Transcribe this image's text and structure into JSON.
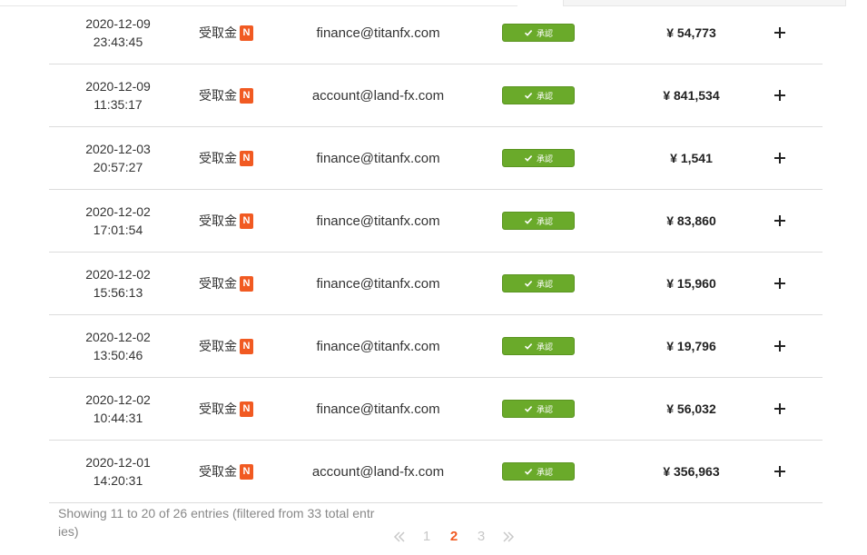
{
  "rows": [
    {
      "date": "2020-12-09",
      "time": "23:43:45",
      "type": "受取金",
      "badge": "N",
      "email": "finance@titanfx.com",
      "status": "承認",
      "amount": "¥ 54,773"
    },
    {
      "date": "2020-12-09",
      "time": "11:35:17",
      "type": "受取金",
      "badge": "N",
      "email": "account@land-fx.com",
      "status": "承認",
      "amount": "¥ 841,534"
    },
    {
      "date": "2020-12-03",
      "time": "20:57:27",
      "type": "受取金",
      "badge": "N",
      "email": "finance@titanfx.com",
      "status": "承認",
      "amount": "¥ 1,541"
    },
    {
      "date": "2020-12-02",
      "time": "17:01:54",
      "type": "受取金",
      "badge": "N",
      "email": "finance@titanfx.com",
      "status": "承認",
      "amount": "¥ 83,860"
    },
    {
      "date": "2020-12-02",
      "time": "15:56:13",
      "type": "受取金",
      "badge": "N",
      "email": "finance@titanfx.com",
      "status": "承認",
      "amount": "¥ 15,960"
    },
    {
      "date": "2020-12-02",
      "time": "13:50:46",
      "type": "受取金",
      "badge": "N",
      "email": "finance@titanfx.com",
      "status": "承認",
      "amount": "¥ 19,796"
    },
    {
      "date": "2020-12-02",
      "time": "10:44:31",
      "type": "受取金",
      "badge": "N",
      "email": "finance@titanfx.com",
      "status": "承認",
      "amount": "¥ 56,032"
    },
    {
      "date": "2020-12-01",
      "time": "14:20:31",
      "type": "受取金",
      "badge": "N",
      "email": "account@land-fx.com",
      "status": "承認",
      "amount": "¥ 356,963"
    }
  ],
  "footer": {
    "info": "Showing 11 to 20 of 26 entries (filtered from 33 total entries)"
  },
  "pagination": {
    "pages": [
      "1",
      "2",
      "3"
    ],
    "current": "2"
  },
  "colors": {
    "accent": "#f15a22",
    "status_green": "#6aaa2a"
  },
  "icons": {
    "status": "check-icon",
    "row_action": "plus-icon",
    "prev": "double-chevron-left-icon",
    "next": "double-chevron-right-icon"
  }
}
